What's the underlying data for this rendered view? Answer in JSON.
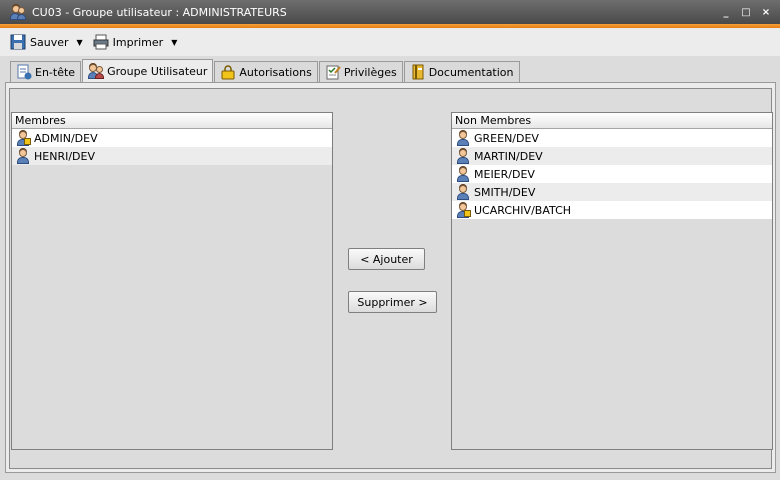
{
  "window": {
    "title": "CU03 - Groupe utilisateur : ADMINISTRATEURS",
    "controls": {
      "minimize": "_",
      "maximize": "□",
      "close": "×"
    }
  },
  "toolbar": {
    "save_label": "Sauver",
    "print_label": "Imprimer",
    "dropdown_glyph": "▼"
  },
  "tabs": [
    {
      "label": "En-tête",
      "icon": "header-doc-icon",
      "active": false
    },
    {
      "label": "Groupe Utilisateur",
      "icon": "user-group-icon",
      "active": true
    },
    {
      "label": "Autorisations",
      "icon": "lock-icon",
      "active": false
    },
    {
      "label": "Privilèges",
      "icon": "privileges-icon",
      "active": false
    },
    {
      "label": "Documentation",
      "icon": "book-icon",
      "active": false
    }
  ],
  "members": {
    "header": "Membres",
    "items": [
      {
        "label": "ADMIN/DEV",
        "icon": "user-lock-icon"
      },
      {
        "label": "HENRI/DEV",
        "icon": "user-icon"
      }
    ]
  },
  "non_members": {
    "header": "Non Membres",
    "items": [
      {
        "label": "GREEN/DEV",
        "icon": "user-icon"
      },
      {
        "label": "MARTIN/DEV",
        "icon": "user-icon"
      },
      {
        "label": "MEIER/DEV",
        "icon": "user-icon"
      },
      {
        "label": "SMITH/DEV",
        "icon": "user-icon"
      },
      {
        "label": "UCARCHIV/BATCH",
        "icon": "user-lock-icon"
      }
    ]
  },
  "actions": {
    "add_label": "< Ajouter",
    "remove_label": "Supprimer >"
  },
  "colors": {
    "accent_stripe": "#e67e12",
    "titlebar": "#4a4a4a"
  }
}
